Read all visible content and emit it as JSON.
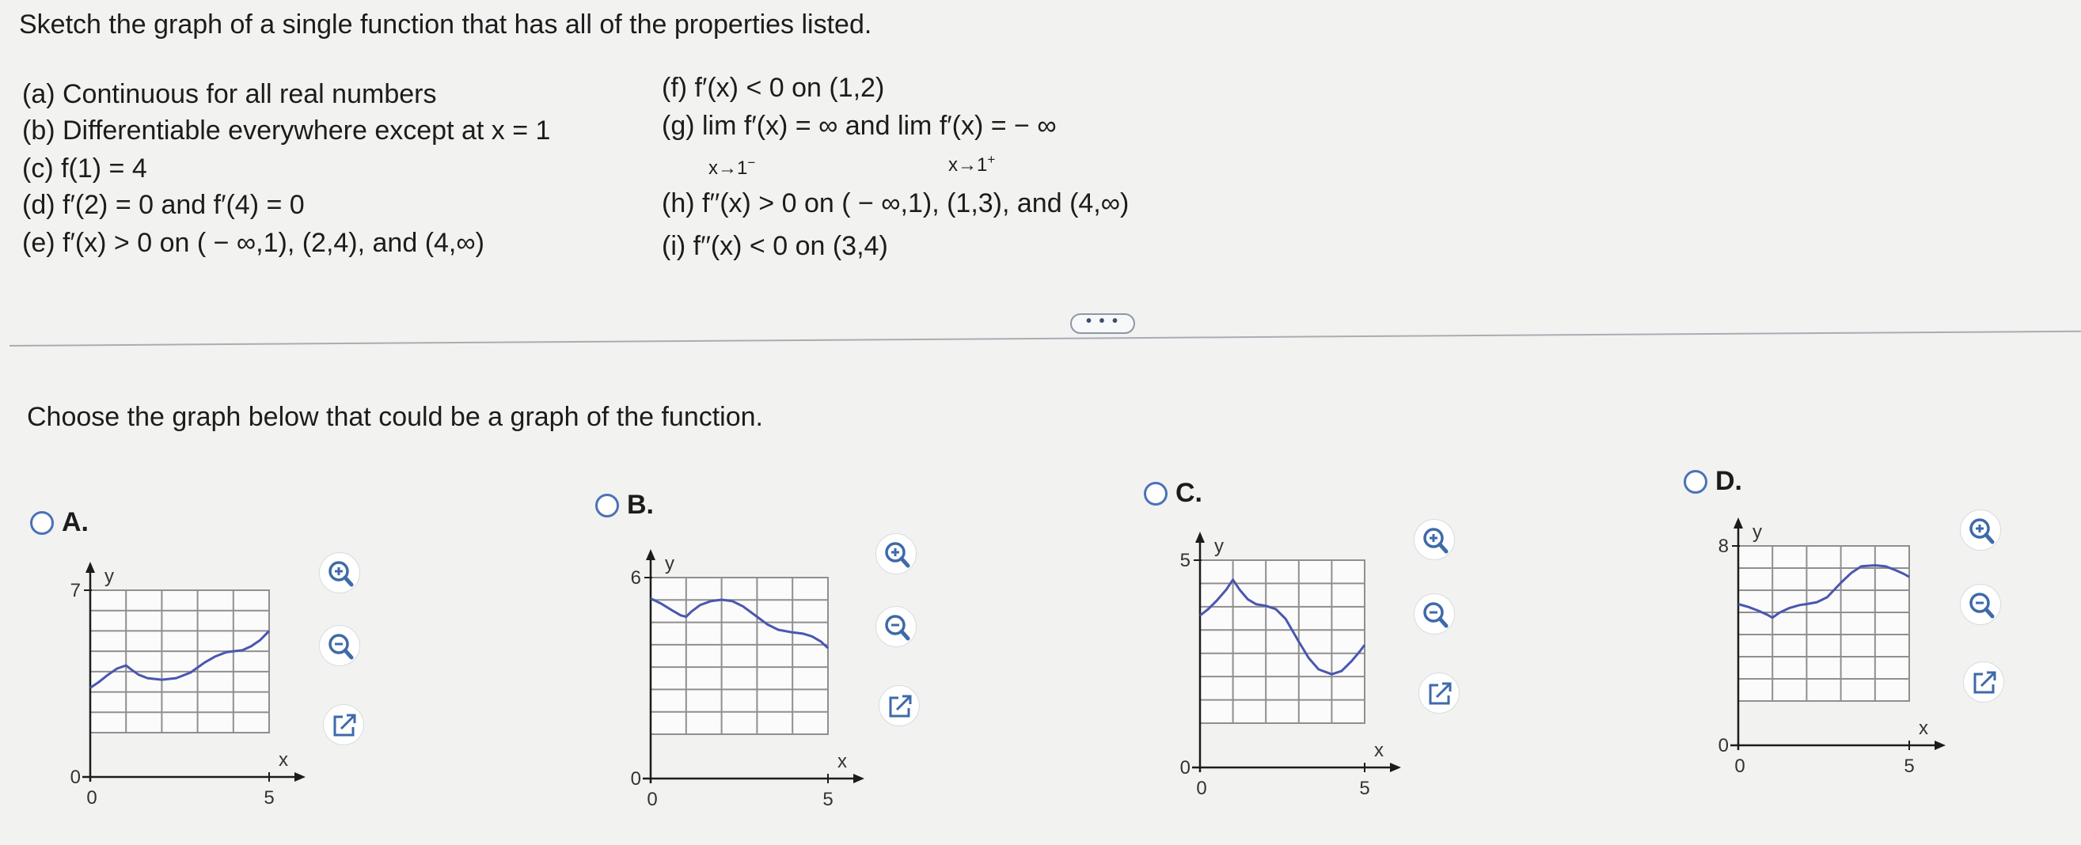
{
  "prompt": "Sketch the graph of a single function that has all of the properties listed.",
  "properties_left": [
    "(a) Continuous for all real numbers",
    "(b) Differentiable everywhere except at x = 1",
    "(c) f(1) = 4",
    "(d) f′(2) = 0 and f′(4) = 0",
    "(e) f′(x) > 0 on ( − ∞,1), (2,4), and (4,∞)"
  ],
  "properties_right": {
    "f": "(f) f′(x) < 0 on (1,2)",
    "g": "(g)  lim  f′(x) = ∞ and   lim  f′(x) = − ∞",
    "g_sub_left": "x→1",
    "g_sub_left_sup": "−",
    "g_sub_right": "x→1",
    "g_sub_right_sup": "+",
    "h": "(h) f′′(x) > 0 on ( − ∞,1), (1,3), and (4,∞)",
    "i": "(i) f′′(x) < 0 on (3,4)"
  },
  "more_button_label": "• • •",
  "question": "Choose the graph below that could be a graph of the function.",
  "options": [
    {
      "letter": "A.",
      "y_axis_label": "y",
      "x_axis_label": "x",
      "y_tick": "7",
      "y_origin_tick": "0",
      "x_origin_tick": "0",
      "x_tick": "5",
      "ymax": 7,
      "xmax": 5,
      "ymin": 0,
      "xmin": 0,
      "curve": [
        [
          0,
          2.2
        ],
        [
          0.25,
          2.5
        ],
        [
          0.5,
          2.85
        ],
        [
          0.75,
          3.15
        ],
        [
          1,
          3.3
        ],
        [
          1.15,
          3.1
        ],
        [
          1.35,
          2.85
        ],
        [
          1.6,
          2.68
        ],
        [
          2,
          2.6
        ],
        [
          2.4,
          2.68
        ],
        [
          2.8,
          2.95
        ],
        [
          3,
          3.2
        ],
        [
          3.2,
          3.45
        ],
        [
          3.5,
          3.75
        ],
        [
          3.8,
          3.95
        ],
        [
          4,
          4
        ],
        [
          4.25,
          4.05
        ],
        [
          4.5,
          4.25
        ],
        [
          4.75,
          4.55
        ],
        [
          5,
          5
        ]
      ]
    },
    {
      "letter": "B.",
      "y_axis_label": "y",
      "x_axis_label": "x",
      "y_tick": "6",
      "y_origin_tick": "0",
      "x_origin_tick": "0",
      "x_tick": "5",
      "ymax": 6,
      "xmax": 5,
      "ymin": 0,
      "xmin": 0,
      "curve": [
        [
          0,
          5.2
        ],
        [
          0.3,
          5
        ],
        [
          0.6,
          4.75
        ],
        [
          0.85,
          4.55
        ],
        [
          1,
          4.5
        ],
        [
          1.15,
          4.7
        ],
        [
          1.4,
          4.95
        ],
        [
          1.7,
          5.1
        ],
        [
          2,
          5.15
        ],
        [
          2.3,
          5.1
        ],
        [
          2.6,
          4.9
        ],
        [
          3,
          4.5
        ],
        [
          3.3,
          4.2
        ],
        [
          3.6,
          4
        ],
        [
          4,
          3.9
        ],
        [
          4.3,
          3.85
        ],
        [
          4.55,
          3.75
        ],
        [
          4.8,
          3.55
        ],
        [
          5,
          3.3
        ]
      ]
    },
    {
      "letter": "C.",
      "y_axis_label": "y",
      "x_axis_label": "x",
      "y_tick": "5",
      "y_origin_tick": "0",
      "x_origin_tick": "0",
      "x_tick": "5",
      "ymax": 5,
      "xmax": 5,
      "ymin": 0,
      "xmin": 0,
      "curve": [
        [
          0,
          3.3
        ],
        [
          0.25,
          3.5
        ],
        [
          0.5,
          3.75
        ],
        [
          0.8,
          4.1
        ],
        [
          1,
          4.4
        ],
        [
          1.2,
          4.1
        ],
        [
          1.45,
          3.8
        ],
        [
          1.7,
          3.65
        ],
        [
          2,
          3.6
        ],
        [
          2.3,
          3.5
        ],
        [
          2.6,
          3.2
        ],
        [
          3,
          2.5
        ],
        [
          3.3,
          2
        ],
        [
          3.6,
          1.65
        ],
        [
          4,
          1.5
        ],
        [
          4.3,
          1.6
        ],
        [
          4.6,
          1.9
        ],
        [
          4.85,
          2.2
        ],
        [
          5,
          2.4
        ]
      ]
    },
    {
      "letter": "D.",
      "y_axis_label": "y",
      "x_axis_label": "x",
      "y_tick": "8",
      "y_origin_tick": "0",
      "x_origin_tick": "0",
      "x_tick": "5",
      "ymax": 8,
      "xmax": 5,
      "ymin": 0,
      "xmin": 0,
      "curve": [
        [
          0,
          5
        ],
        [
          0.3,
          4.85
        ],
        [
          0.6,
          4.65
        ],
        [
          0.85,
          4.45
        ],
        [
          1,
          4.3
        ],
        [
          1.2,
          4.55
        ],
        [
          1.5,
          4.8
        ],
        [
          1.8,
          4.95
        ],
        [
          2,
          5
        ],
        [
          2.3,
          5.1
        ],
        [
          2.6,
          5.35
        ],
        [
          3,
          6.1
        ],
        [
          3.3,
          6.6
        ],
        [
          3.6,
          6.95
        ],
        [
          4,
          7
        ],
        [
          4.3,
          6.95
        ],
        [
          4.6,
          6.75
        ],
        [
          4.85,
          6.55
        ],
        [
          5,
          6.4
        ]
      ]
    }
  ],
  "tools": [
    "zoom-in-icon",
    "zoom-out-icon",
    "open-external-icon"
  ],
  "colors": {
    "curve": "#4a56b0",
    "grid": "#8f8f8f",
    "axis": "#1c1c1c",
    "radio": "#4a72b8",
    "tool_icon": "#3e6aa8"
  }
}
